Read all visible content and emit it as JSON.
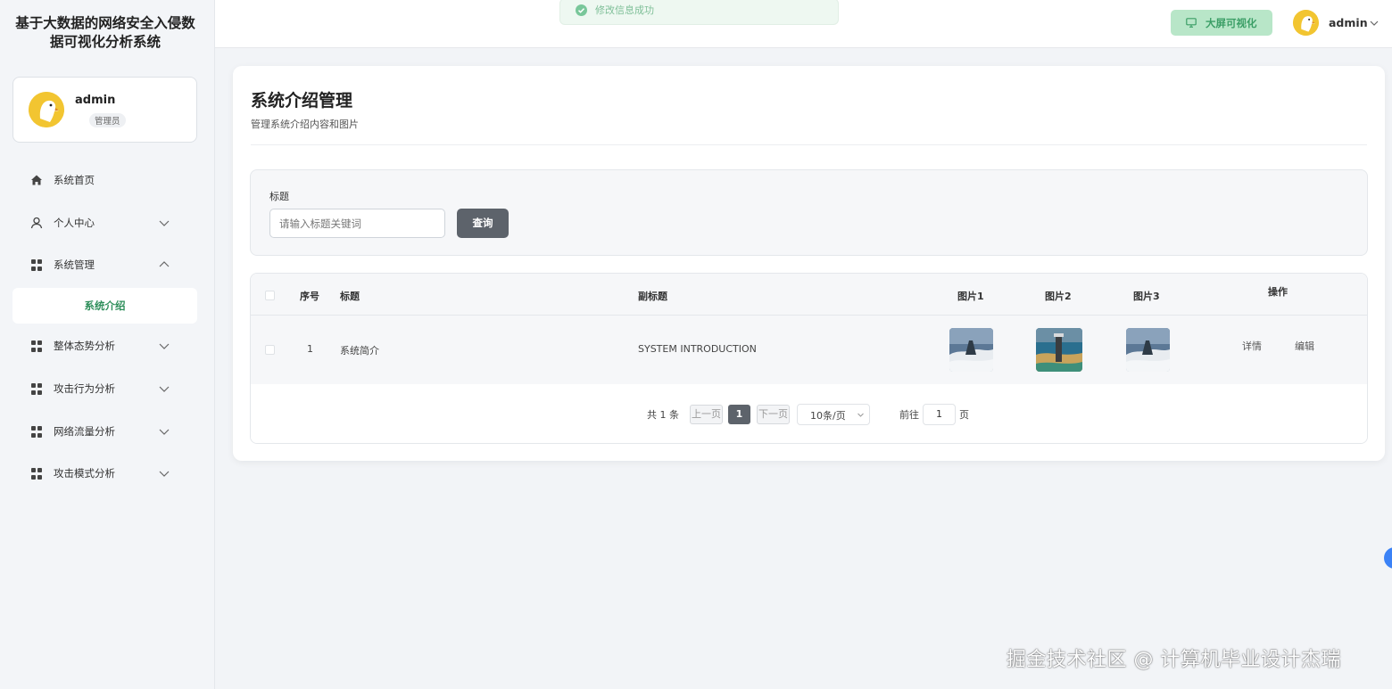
{
  "app": {
    "title": "基于大数据的网络安全入侵数据可视化分析系统"
  },
  "sidebar": {
    "user": {
      "name": "admin",
      "role": "管理员"
    },
    "items": [
      {
        "label": "系统首页",
        "icon": "home-icon"
      },
      {
        "label": "个人中心",
        "icon": "user-icon"
      },
      {
        "label": "系统管理",
        "icon": "grid-icon",
        "expanded": true
      },
      {
        "label": "系统介绍"
      },
      {
        "label": "整体态势分析",
        "icon": "grid-icon"
      },
      {
        "label": "攻击行为分析",
        "icon": "grid-icon"
      },
      {
        "label": "网络流量分析",
        "icon": "grid-icon"
      },
      {
        "label": "攻击模式分析",
        "icon": "grid-icon"
      }
    ]
  },
  "header": {
    "toast": "修改信息成功",
    "bigscreen_label": "大屏可视化",
    "user_name": "admin"
  },
  "page": {
    "title": "系统介绍管理",
    "subtitle": "管理系统介绍内容和图片"
  },
  "search": {
    "label": "标题",
    "placeholder": "请输入标题关键词",
    "button": "查询"
  },
  "table": {
    "columns": [
      "序号",
      "标题",
      "副标题",
      "图片1",
      "图片2",
      "图片3",
      "操作"
    ],
    "rows": [
      {
        "index": "1",
        "title": "系统简介",
        "subtitle": "SYSTEM INTRODUCTION",
        "actions": [
          "详情",
          "编辑"
        ]
      }
    ]
  },
  "pagination": {
    "total": "共 1 条",
    "prev": "上一页",
    "current": "1",
    "next": "下一页",
    "page_size": "10条/页",
    "goto_label": "前往",
    "goto_value": "1",
    "page_suffix": "页"
  },
  "watermark": "掘金技术社区 @ 计算机毕业设计杰瑞",
  "colors": {
    "accent": "#2f8f5b",
    "bigscreen_bg": "#b8e6c8",
    "primary_btn": "#5d636b"
  }
}
